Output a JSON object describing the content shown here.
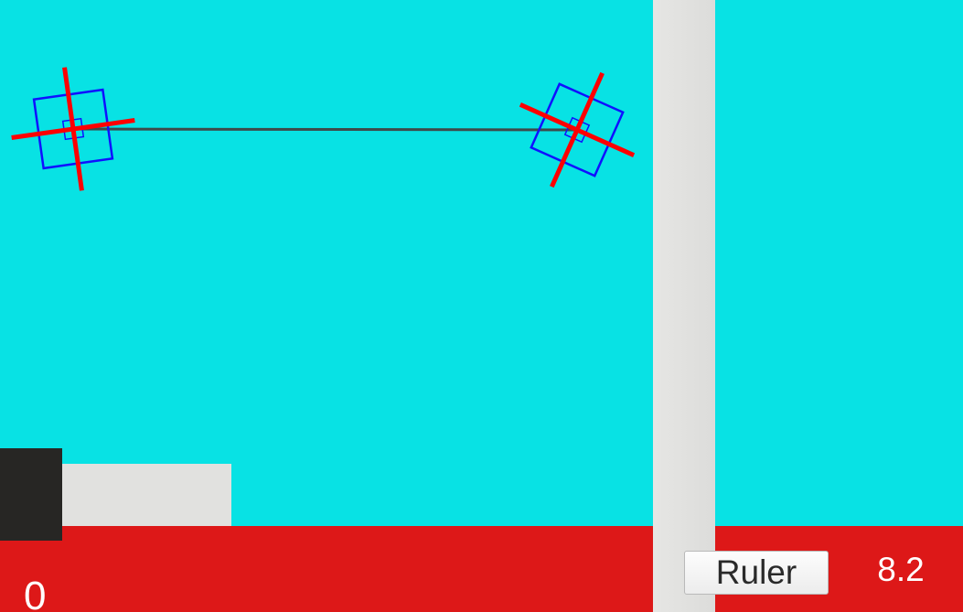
{
  "scene": {
    "background_color": "#08e2e4",
    "floor_color": "#dd1818",
    "pillar_color": "#e2e2e0",
    "ledge_color": "#e1e1df",
    "block_color": "#272624"
  },
  "markers": {
    "crosshair_color": "#ff0000",
    "frame_color": "#1010ff",
    "line_color": "#3d4a4a",
    "icons": [
      "crosshair-icon",
      "crosshair-icon"
    ]
  },
  "hud": {
    "ruler_label": "Ruler",
    "distance_value": "8.2",
    "score_value": "0"
  }
}
